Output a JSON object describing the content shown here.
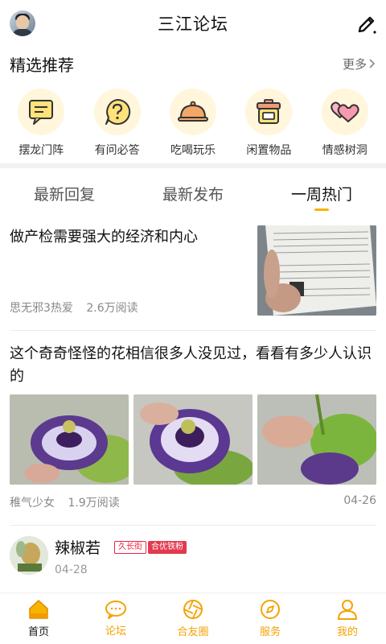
{
  "header": {
    "title": "三江论坛"
  },
  "featured": {
    "title": "精选推荐",
    "more_label": "更多",
    "categories": [
      {
        "label": "摆龙门阵",
        "icon": "chat-bubble-icon"
      },
      {
        "label": "有问必答",
        "icon": "question-icon"
      },
      {
        "label": "吃喝玩乐",
        "icon": "food-cover-icon"
      },
      {
        "label": "闲置物品",
        "icon": "storage-jar-icon"
      },
      {
        "label": "情感树洞",
        "icon": "hearts-icon"
      }
    ]
  },
  "tabs": [
    {
      "label": "最新回复"
    },
    {
      "label": "最新发布"
    },
    {
      "label": "一周热门"
    }
  ],
  "posts": [
    {
      "title": "做产检需要强大的经济和内心",
      "author": "思无邪3热爱",
      "reads": "2.6万阅读"
    },
    {
      "title": "这个奇奇怪怪的花相信很多人没见过，看看有多少人认识的",
      "author": "稚气少女",
      "reads": "1.9万阅读",
      "date": "04-26"
    },
    {
      "author": "辣椒若",
      "badge1": "久长街",
      "badge2": "合优铁粉",
      "date": "04-28"
    }
  ],
  "bottom_nav": [
    {
      "label": "首页"
    },
    {
      "label": "论坛"
    },
    {
      "label": "合友圈"
    },
    {
      "label": "服务"
    },
    {
      "label": "我的"
    }
  ],
  "colors": {
    "accent": "#f5b400",
    "badge_red": "#e2394f"
  }
}
